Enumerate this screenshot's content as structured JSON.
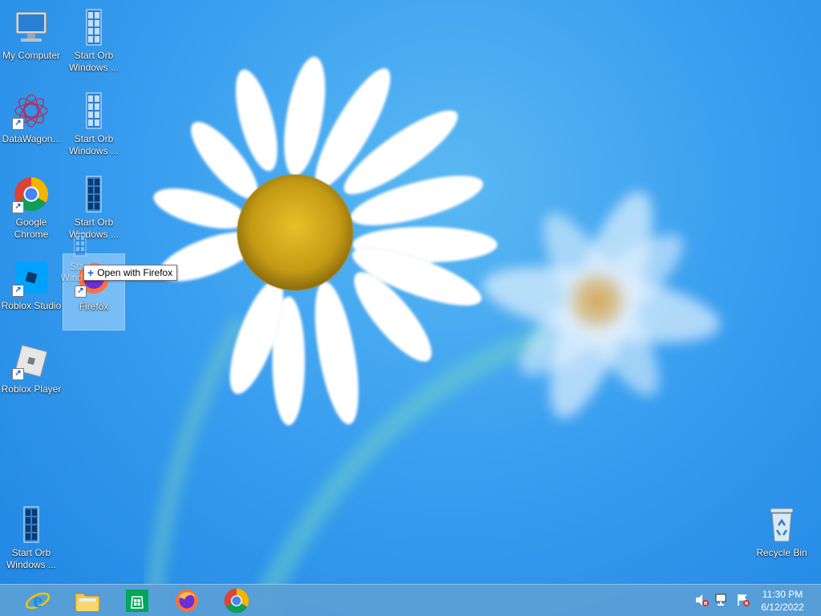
{
  "desktop": {
    "icons": [
      {
        "label": "My Computer",
        "icon": "computer-icon"
      },
      {
        "label": "Start Orb Windows ...",
        "icon": "start-orb-icon"
      },
      {
        "label": "DataWagon...",
        "icon": "datawagon-icon"
      },
      {
        "label": "Start Orb Windows ...",
        "icon": "start-orb-icon"
      },
      {
        "label": "Google Chrome",
        "icon": "chrome-icon"
      },
      {
        "label": "Start Orb Windows ...",
        "icon": "start-orb-icon"
      },
      {
        "label": "Roblox Studio",
        "icon": "roblox-studio-icon"
      },
      {
        "label": "Firefox",
        "icon": "firefox-icon"
      },
      {
        "label": "Roblox Player",
        "icon": "roblox-player-icon"
      },
      {
        "label": "Start Orb Windows ...",
        "icon": "start-orb-icon"
      },
      {
        "label": "Recycle Bin",
        "icon": "recycle-bin-icon"
      }
    ],
    "drag_ghost_label": "Start Windows ..."
  },
  "tooltip": {
    "text": "Open with Firefox"
  },
  "taskbar": {
    "pinned": [
      {
        "name": "Internet Explorer",
        "icon": "internet-explorer-icon"
      },
      {
        "name": "File Explorer",
        "icon": "folder-icon"
      },
      {
        "name": "Store",
        "icon": "store-icon"
      },
      {
        "name": "Firefox",
        "icon": "firefox-icon"
      },
      {
        "name": "Google Chrome",
        "icon": "chrome-icon"
      }
    ],
    "tray": [
      {
        "icon": "volume-muted-icon"
      },
      {
        "icon": "network-icon"
      },
      {
        "icon": "action-center-icon"
      }
    ],
    "clock": {
      "time": "11:30 PM",
      "date": "6/12/2022"
    }
  },
  "colors": {
    "wallpaper": "#3a9ff0",
    "taskbar": "#5aa0d7",
    "selection": "#cce8ff"
  }
}
